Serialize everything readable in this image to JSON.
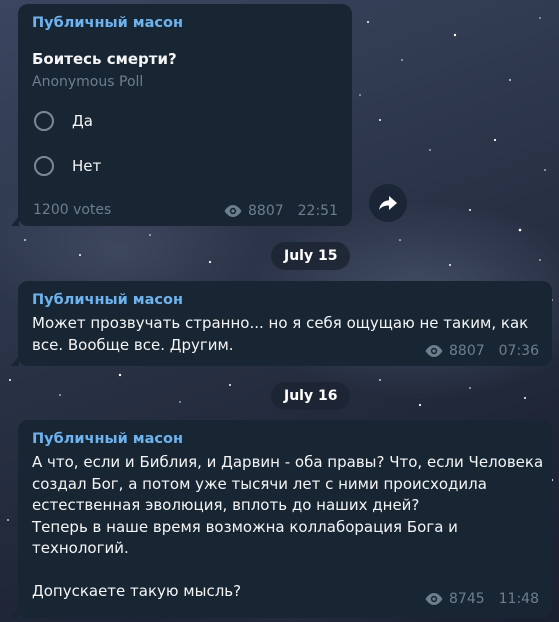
{
  "messages": [
    {
      "author": "Публичный масон",
      "poll": {
        "question": "Боитесь смерти?",
        "type": "Anonymous Poll",
        "options": [
          "Да",
          "Нет"
        ],
        "votes": "1200 votes"
      },
      "views": "8807",
      "time": "22:51"
    },
    {
      "author": "Публичный масон",
      "text": "Может прозвучать странно... но я себя ощущаю не таким, как\nвсе. Вообще все. Другим.",
      "views": "8807",
      "time": "07:36"
    },
    {
      "author": "Публичный масон",
      "text": "А что, если и Библия, и Дарвин - оба правы? Что, если Человека\nсоздал Бог, а потом уже тысячи лет с ними происходила\nестественная эволюция, вплоть до наших дней?\nТеперь в наше время возможна коллаборация Бога и\nтехнологий.\n\nДопускаете такую мысль?",
      "views": "8745",
      "time": "11:48"
    }
  ],
  "dates": [
    "July 15",
    "July 16"
  ],
  "icons": {
    "views": "eye-icon",
    "share": "share-arrow-icon"
  },
  "colors": {
    "bubble": "#182533",
    "author": "#6fb3ee",
    "meta": "#6d7f8f"
  }
}
